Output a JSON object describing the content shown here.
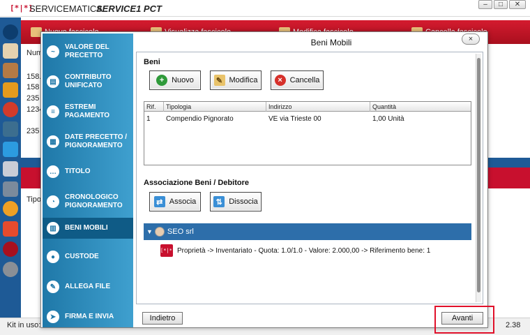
{
  "app": {
    "brand": "SERVICEMATICA",
    "product": "SERVICE1 PCT",
    "logo": "[*|*]",
    "kit_label": "Kit in uso:",
    "version": "2.38"
  },
  "window_controls": {
    "min": "–",
    "max": "□",
    "close": "✕"
  },
  "colors": {
    "header_red": "#c8102e",
    "nav_blue": "#2a8bc1",
    "tree_blue": "#2d6eaa",
    "highlight_red": "#e0102a"
  },
  "background": {
    "tabs": [
      "Nuovo fascicolo",
      "Visualizza fascicolo",
      "Modifica fascicolo",
      "Cancella fascicolo"
    ],
    "column_label": "Num",
    "rows": [
      "158.",
      "158",
      "235",
      "1234",
      "235"
    ],
    "bottom_column": "Tipo"
  },
  "dialog": {
    "title": "Beni Mobili",
    "close_label": "×",
    "nav": [
      {
        "label": "VALORE DEL PRECETTO",
        "icon": "pulse-icon"
      },
      {
        "label": "CONTRIBUTO UNIFICATO",
        "icon": "receipt-icon"
      },
      {
        "label": "ESTREMI PAGAMENTO",
        "icon": "document-icon"
      },
      {
        "label": "DATE PRECETTO / PIGNORAMENTO",
        "icon": "calendar-icon"
      },
      {
        "label": "TITOLO",
        "icon": "speech-icon"
      },
      {
        "label": "CRONOLOGICO PIGNORAMENTO",
        "icon": "pie-icon"
      },
      {
        "label": "BENI MOBILI",
        "icon": "drawer-icon"
      },
      {
        "label": "CUSTODE",
        "icon": "person-icon"
      },
      {
        "label": "ALLEGA FILE",
        "icon": "pin-icon"
      },
      {
        "label": "FIRMA E INVIA",
        "icon": "send-icon"
      }
    ],
    "active_nav": "BENI MOBILI",
    "beni": {
      "section_label": "Beni",
      "buttons": {
        "new": "Nuovo",
        "edit": "Modifica",
        "delete": "Cancella"
      },
      "table": {
        "headers": [
          "Rif.",
          "Tipologia",
          "Indirizzo",
          "Quantità"
        ],
        "rows": [
          [
            "1",
            "Compendio Pignorato",
            "VE via Trieste 00",
            "1,00 Unità"
          ]
        ]
      }
    },
    "associazione": {
      "section_label": "Associazione Beni / Debitore",
      "buttons": {
        "associate": "Associa",
        "dissociate": "Dissocia"
      },
      "tree": {
        "debtor": "SEO srl",
        "child": "Proprietà -> Inventariato - Quota: 1.0/1.0 - Valore: 2.000,00 -> Riferimento bene: 1"
      }
    },
    "footer": {
      "back": "Indietro",
      "next": "Avanti"
    }
  }
}
